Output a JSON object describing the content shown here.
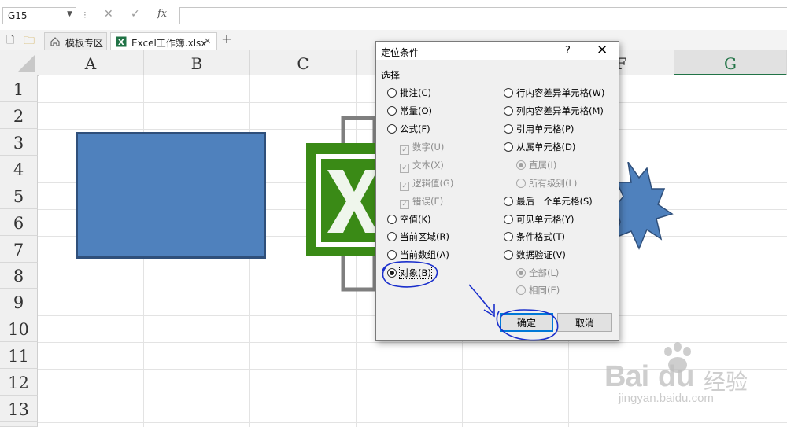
{
  "formula_bar": {
    "name_box": "G15",
    "separator": "⁝",
    "cancel_glyph": "✕",
    "enter_glyph": "✓",
    "fx_label": "fx",
    "formula_value": ""
  },
  "tabs": {
    "new_glyph": "🗋",
    "open_glyph": "🗀",
    "items": [
      {
        "label": "模板专区"
      },
      {
        "label": "Excel工作簿.xlsx"
      }
    ],
    "close_glyph": "✕",
    "add_glyph": "+"
  },
  "columns": [
    "A",
    "B",
    "C",
    "D",
    "E",
    "F",
    "G"
  ],
  "rows": [
    "1",
    "2",
    "3",
    "4",
    "5",
    "6",
    "7",
    "8",
    "9",
    "10",
    "11",
    "12",
    "13"
  ],
  "colors": {
    "accent_green": "#217346",
    "rectangle_fill": "#4f81bd",
    "rectangle_border": "#2f4f7a",
    "annotation_blue": "#1a2fcc"
  },
  "dialog": {
    "title": "定位条件",
    "help": "?",
    "close": "✕",
    "group_label": "选择",
    "left_options": [
      {
        "label": "批注(C)"
      },
      {
        "label": "常量(O)"
      },
      {
        "label": "公式(F)"
      },
      {
        "label": "数字(U)"
      },
      {
        "label": "文本(X)"
      },
      {
        "label": "逻辑值(G)"
      },
      {
        "label": "错误(E)"
      },
      {
        "label": "空值(K)"
      },
      {
        "label": "当前区域(R)"
      },
      {
        "label": "当前数组(A)"
      },
      {
        "label": "对象(B)"
      }
    ],
    "right_options": [
      {
        "label": "行内容差异单元格(W)"
      },
      {
        "label": "列内容差异单元格(M)"
      },
      {
        "label": "引用单元格(P)"
      },
      {
        "label": "从属单元格(D)"
      },
      {
        "label": "直属(I)"
      },
      {
        "label": "所有级别(L)"
      },
      {
        "label": "最后一个单元格(S)"
      },
      {
        "label": "可见单元格(Y)"
      },
      {
        "label": "条件格式(T)"
      },
      {
        "label": "数据验证(V)"
      },
      {
        "label": "全部(L)"
      },
      {
        "label": "相同(E)"
      }
    ],
    "selected_option": "对象(B)",
    "ok_label": "确定",
    "cancel_label": "取消"
  },
  "watermark": {
    "brand": "Bai",
    "brand_2": "du",
    "cn": "经验",
    "url": "jingyan.baidu.com"
  }
}
